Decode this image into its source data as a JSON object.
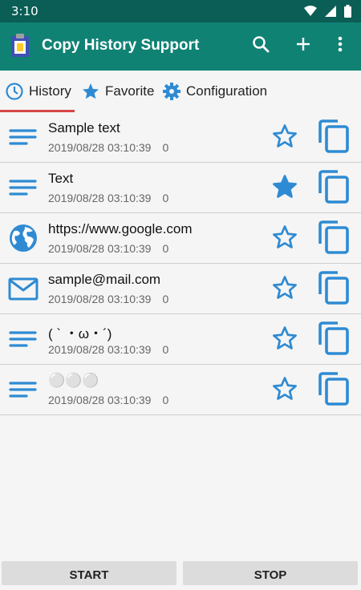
{
  "status": {
    "time": "3:10"
  },
  "app": {
    "title": "Copy History Support"
  },
  "tabs": [
    {
      "label": "History",
      "icon": "clock-icon"
    },
    {
      "label": "Favorite",
      "icon": "star-icon"
    },
    {
      "label": "Configuration",
      "icon": "gear-icon"
    }
  ],
  "items": [
    {
      "text": "Sample text",
      "date": "2019/08/28 03:10:39",
      "count": "0",
      "type": "text-icon",
      "favorite": false
    },
    {
      "text": "Text",
      "date": "2019/08/28 03:10:39",
      "count": "0",
      "type": "text-icon",
      "favorite": true
    },
    {
      "text": "https://www.google.com",
      "date": "2019/08/28 03:10:39",
      "count": "0",
      "type": "globe-icon",
      "favorite": false
    },
    {
      "text": "sample@mail.com",
      "date": "2019/08/28 03:10:39",
      "count": "0",
      "type": "mail-icon",
      "favorite": false
    },
    {
      "text": "( ` ・ω・´)",
      "date": "2019/08/28 03:10:39",
      "count": "0",
      "type": "text-icon",
      "favorite": false
    },
    {
      "text": "⚪⚪⚪",
      "date": "2019/08/28 03:10:39",
      "count": "0",
      "type": "text-icon",
      "favorite": false
    }
  ],
  "buttons": {
    "start": "START",
    "stop": "STOP"
  },
  "colors": {
    "primary": "#108274",
    "accent": "#2e8bd3",
    "status": "#0a5e55",
    "tab_indicator": "#d64545"
  }
}
